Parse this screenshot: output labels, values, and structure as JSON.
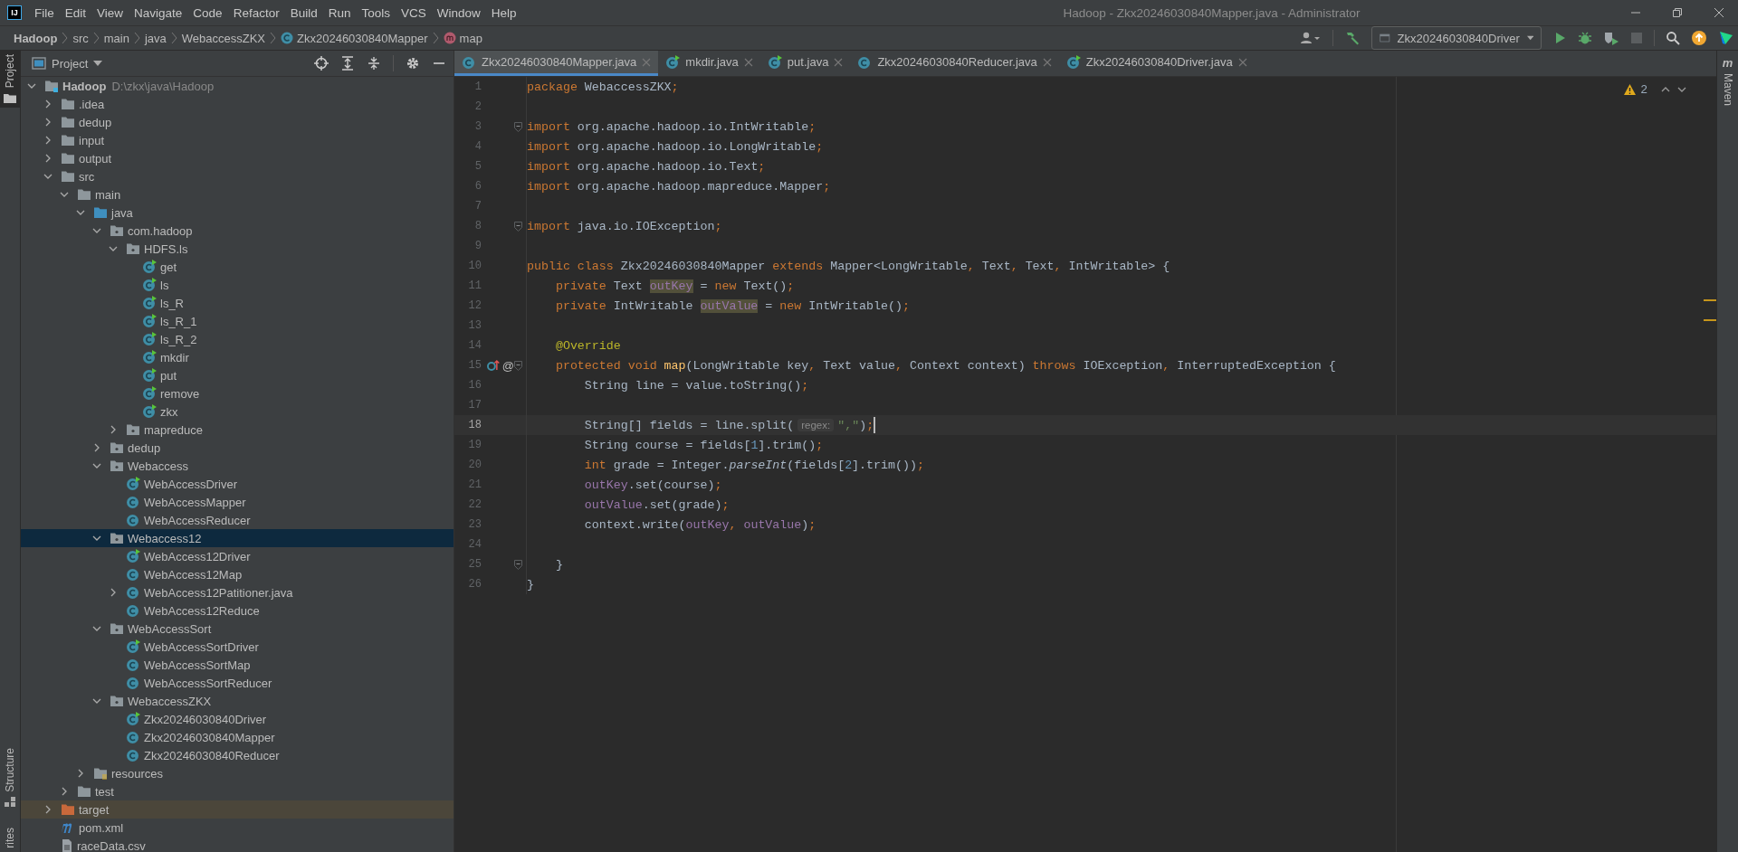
{
  "window": {
    "logo": "IJ",
    "title": "Hadoop - Zkx20246030840Mapper.java - Administrator"
  },
  "menu": [
    "File",
    "Edit",
    "View",
    "Navigate",
    "Code",
    "Refactor",
    "Build",
    "Run",
    "Tools",
    "VCS",
    "Window",
    "Help"
  ],
  "breadcrumb": [
    {
      "label": "Hadoop",
      "kind": "project"
    },
    {
      "label": "src",
      "kind": "folder"
    },
    {
      "label": "main",
      "kind": "folder"
    },
    {
      "label": "java",
      "kind": "folder"
    },
    {
      "label": "WebaccessZKX",
      "kind": "folder"
    },
    {
      "label": "Zkx20246030840Mapper",
      "kind": "class"
    },
    {
      "label": "map",
      "kind": "method"
    }
  ],
  "run_config": "Zkx20246030840Driver",
  "left_stripe": {
    "top": [
      {
        "label": "Project",
        "selected": true
      }
    ],
    "bottom": [
      {
        "label": "Structure",
        "selected": false
      },
      {
        "label": "rites",
        "selected": false
      }
    ]
  },
  "project_panel": {
    "title": "Project"
  },
  "tree": [
    {
      "label": "Hadoop",
      "path": "D:\\zkx\\java\\Hadoop",
      "kind": "module",
      "expanded": true,
      "selected": false,
      "children": [
        {
          "label": ".idea",
          "kind": "folder",
          "expanded": false,
          "selected": false
        },
        {
          "label": "dedup",
          "kind": "folder",
          "expanded": false,
          "selected": false
        },
        {
          "label": "input",
          "kind": "folder",
          "expanded": false,
          "selected": false
        },
        {
          "label": "output",
          "kind": "folder",
          "expanded": false,
          "selected": false
        },
        {
          "label": "src",
          "kind": "folder",
          "expanded": true,
          "selected": false,
          "children": [
            {
              "label": "main",
              "kind": "folder",
              "expanded": true,
              "selected": false,
              "children": [
                {
                  "label": "java",
                  "kind": "source",
                  "expanded": true,
                  "selected": false,
                  "children": [
                    {
                      "label": "com.hadoop",
                      "kind": "package",
                      "expanded": true,
                      "selected": false,
                      "children": [
                        {
                          "label": "HDFS.ls",
                          "kind": "package",
                          "expanded": true,
                          "selected": false,
                          "children": [
                            {
                              "label": "get",
                              "kind": "runclass",
                              "selected": false
                            },
                            {
                              "label": "ls",
                              "kind": "runclass",
                              "selected": false
                            },
                            {
                              "label": "ls_R",
                              "kind": "runclass",
                              "selected": false
                            },
                            {
                              "label": "ls_R_1",
                              "kind": "runclass",
                              "selected": false
                            },
                            {
                              "label": "ls_R_2",
                              "kind": "runclass",
                              "selected": false
                            },
                            {
                              "label": "mkdir",
                              "kind": "runclass",
                              "selected": false
                            },
                            {
                              "label": "put",
                              "kind": "runclass",
                              "selected": false
                            },
                            {
                              "label": "remove",
                              "kind": "runclass",
                              "selected": false
                            },
                            {
                              "label": "zkx",
                              "kind": "runclass",
                              "selected": false
                            }
                          ]
                        },
                        {
                          "label": "mapreduce",
                          "kind": "package",
                          "expanded": false,
                          "selected": false
                        }
                      ]
                    },
                    {
                      "label": "dedup",
                      "kind": "package",
                      "expanded": false,
                      "selected": false
                    },
                    {
                      "label": "Webaccess",
                      "kind": "package",
                      "expanded": true,
                      "selected": false,
                      "children": [
                        {
                          "label": "WebAccessDriver",
                          "kind": "runclass",
                          "selected": false
                        },
                        {
                          "label": "WebAccessMapper",
                          "kind": "class",
                          "selected": false
                        },
                        {
                          "label": "WebAccessReducer",
                          "kind": "class",
                          "selected": false
                        }
                      ]
                    },
                    {
                      "label": "Webaccess12",
                      "kind": "package",
                      "expanded": true,
                      "selected": true,
                      "children": [
                        {
                          "label": "WebAccess12Driver",
                          "kind": "runclass",
                          "selected": false
                        },
                        {
                          "label": "WebAccess12Map",
                          "kind": "class",
                          "selected": false
                        },
                        {
                          "label": "WebAccess12Patitioner.java",
                          "kind": "class",
                          "expanded": false,
                          "selected": false
                        },
                        {
                          "label": "WebAccess12Reduce",
                          "kind": "class",
                          "selected": false
                        }
                      ]
                    },
                    {
                      "label": "WebAccessSort",
                      "kind": "package",
                      "expanded": true,
                      "selected": false,
                      "children": [
                        {
                          "label": "WebAccessSortDriver",
                          "kind": "runclass",
                          "selected": false
                        },
                        {
                          "label": "WebAccessSortMap",
                          "kind": "class",
                          "selected": false
                        },
                        {
                          "label": "WebAccessSortReducer",
                          "kind": "class",
                          "selected": false
                        }
                      ]
                    },
                    {
                      "label": "WebaccessZKX",
                      "kind": "package",
                      "expanded": true,
                      "selected": false,
                      "children": [
                        {
                          "label": "Zkx20246030840Driver",
                          "kind": "runclass",
                          "selected": false
                        },
                        {
                          "label": "Zkx20246030840Mapper",
                          "kind": "class",
                          "selected": false
                        },
                        {
                          "label": "Zkx20246030840Reducer",
                          "kind": "class",
                          "selected": false
                        }
                      ]
                    }
                  ]
                },
                {
                  "label": "resources",
                  "kind": "resources",
                  "expanded": false,
                  "selected": false
                }
              ]
            },
            {
              "label": "test",
              "kind": "folder",
              "expanded": false,
              "selected": false
            }
          ]
        },
        {
          "label": "target",
          "kind": "excluded",
          "expanded": false,
          "selected": false
        },
        {
          "label": "pom.xml",
          "kind": "maven",
          "selected": false
        },
        {
          "label": "raceData.csv",
          "kind": "csv",
          "selected": false
        }
      ]
    }
  ],
  "tabs": [
    {
      "label": "Zkx20246030840Mapper.java",
      "kind": "class",
      "selected": true
    },
    {
      "label": "mkdir.java",
      "kind": "runclass",
      "selected": false
    },
    {
      "label": "put.java",
      "kind": "runclass",
      "selected": false
    },
    {
      "label": "Zkx20246030840Reducer.java",
      "kind": "class",
      "selected": false
    },
    {
      "label": "Zkx20246030840Driver.java",
      "kind": "runclass",
      "selected": false
    }
  ],
  "inspection": {
    "warnings": "2"
  },
  "right_stripe": {
    "icon": "m",
    "label": "Maven"
  },
  "code": [
    {
      "number": "1",
      "tokens": [
        {
          "kind": "kw",
          "text": "package"
        },
        {
          "kind": "txt",
          "text": " WebaccessZKX"
        },
        {
          "kind": "kw",
          "text": ";"
        }
      ]
    },
    {
      "number": "2"
    },
    {
      "number": "3",
      "fold": true,
      "tokens": [
        {
          "kind": "kw",
          "text": "import"
        },
        {
          "kind": "txt",
          "text": " org.apache.hadoop.io.IntWritable"
        },
        {
          "kind": "kw",
          "text": ";"
        }
      ]
    },
    {
      "number": "4",
      "tokens": [
        {
          "kind": "kw",
          "text": "import"
        },
        {
          "kind": "txt",
          "text": " org.apache.hadoop.io.LongWritable"
        },
        {
          "kind": "kw",
          "text": ";"
        }
      ]
    },
    {
      "number": "5",
      "tokens": [
        {
          "kind": "kw",
          "text": "import"
        },
        {
          "kind": "txt",
          "text": " org.apache.hadoop.io.Text"
        },
        {
          "kind": "kw",
          "text": ";"
        }
      ]
    },
    {
      "number": "6",
      "tokens": [
        {
          "kind": "kw",
          "text": "import"
        },
        {
          "kind": "txt",
          "text": " org.apache.hadoop.mapreduce.Mapper"
        },
        {
          "kind": "kw",
          "text": ";"
        }
      ]
    },
    {
      "number": "7"
    },
    {
      "number": "8",
      "fold": true,
      "tokens": [
        {
          "kind": "kw",
          "text": "import"
        },
        {
          "kind": "txt",
          "text": " java.io.IOException"
        },
        {
          "kind": "kw",
          "text": ";"
        }
      ]
    },
    {
      "number": "9"
    },
    {
      "number": "10",
      "tokens": [
        {
          "kind": "kw",
          "text": "public class"
        },
        {
          "kind": "txt",
          "text": " Zkx20246030840Mapper "
        },
        {
          "kind": "kw",
          "text": "extends"
        },
        {
          "kind": "txt",
          "text": " Mapper<LongWritable"
        },
        {
          "kind": "kw",
          "text": ","
        },
        {
          "kind": "txt",
          "text": " Text"
        },
        {
          "kind": "kw",
          "text": ","
        },
        {
          "kind": "txt",
          "text": " Text"
        },
        {
          "kind": "kw",
          "text": ","
        },
        {
          "kind": "txt",
          "text": " IntWritable> {"
        }
      ]
    },
    {
      "number": "11",
      "tokens": [
        {
          "kind": "kw",
          "text": "    private"
        },
        {
          "kind": "txt",
          "text": " Text "
        },
        {
          "kind": "unused",
          "text": "outKey"
        },
        {
          "kind": "txt",
          "text": " = "
        },
        {
          "kind": "kw",
          "text": "new"
        },
        {
          "kind": "txt",
          "text": " Text()"
        },
        {
          "kind": "kw",
          "text": ";"
        }
      ]
    },
    {
      "number": "12",
      "tokens": [
        {
          "kind": "kw",
          "text": "    private"
        },
        {
          "kind": "txt",
          "text": " IntWritable "
        },
        {
          "kind": "unused",
          "text": "outValue"
        },
        {
          "kind": "txt",
          "text": " = "
        },
        {
          "kind": "kw",
          "text": "new"
        },
        {
          "kind": "txt",
          "text": " IntWritable()"
        },
        {
          "kind": "kw",
          "text": ";"
        }
      ]
    },
    {
      "number": "13"
    },
    {
      "number": "14",
      "tokens": [
        {
          "kind": "annot",
          "text": "    @Override"
        }
      ]
    },
    {
      "number": "15",
      "fold": true,
      "overrides": true,
      "annotation_mark": "@",
      "tokens": [
        {
          "kind": "kw",
          "text": "    protected void "
        },
        {
          "kind": "method",
          "text": "map"
        },
        {
          "kind": "txt",
          "text": "(LongWritable key"
        },
        {
          "kind": "kw",
          "text": ","
        },
        {
          "kind": "txt",
          "text": " Text value"
        },
        {
          "kind": "kw",
          "text": ","
        },
        {
          "kind": "txt",
          "text": " Context context) "
        },
        {
          "kind": "kw",
          "text": "throws"
        },
        {
          "kind": "txt",
          "text": " IOException"
        },
        {
          "kind": "kw",
          "text": ","
        },
        {
          "kind": "txt",
          "text": " InterruptedException {"
        }
      ]
    },
    {
      "number": "16",
      "tokens": [
        {
          "kind": "txt",
          "text": "        String line = value.toString()"
        },
        {
          "kind": "kw",
          "text": ";"
        }
      ]
    },
    {
      "number": "17"
    },
    {
      "number": "18",
      "current": true,
      "tokens": [
        {
          "kind": "txt",
          "text": "        String[] fields = line.split("
        },
        {
          "kind": "hint",
          "text": "regex:"
        },
        {
          "kind": "str",
          "text": "\",\""
        },
        {
          "kind": "txt",
          "text": ")"
        },
        {
          "kind": "kw",
          "text": ";"
        }
      ]
    },
    {
      "number": "19",
      "tokens": [
        {
          "kind": "txt",
          "text": "        String course = fields["
        },
        {
          "kind": "num",
          "text": "1"
        },
        {
          "kind": "txt",
          "text": "].trim()"
        },
        {
          "kind": "kw",
          "text": ";"
        }
      ]
    },
    {
      "number": "20",
      "tokens": [
        {
          "kind": "kw",
          "text": "        int"
        },
        {
          "kind": "txt",
          "text": " grade = Integer."
        },
        {
          "kind": "static",
          "text": "parseInt"
        },
        {
          "kind": "txt",
          "text": "(fields["
        },
        {
          "kind": "num",
          "text": "2"
        },
        {
          "kind": "txt",
          "text": "].trim())"
        },
        {
          "kind": "kw",
          "text": ";"
        }
      ]
    },
    {
      "number": "21",
      "tokens": [
        {
          "kind": "field",
          "text": "        outKey"
        },
        {
          "kind": "txt",
          "text": ".set(course)"
        },
        {
          "kind": "kw",
          "text": ";"
        }
      ]
    },
    {
      "number": "22",
      "tokens": [
        {
          "kind": "field",
          "text": "        outValue"
        },
        {
          "kind": "txt",
          "text": ".set(grade)"
        },
        {
          "kind": "kw",
          "text": ";"
        }
      ]
    },
    {
      "number": "23",
      "tokens": [
        {
          "kind": "txt",
          "text": "        context.write("
        },
        {
          "kind": "field",
          "text": "outKey"
        },
        {
          "kind": "kw",
          "text": ", "
        },
        {
          "kind": "field",
          "text": "outValue"
        },
        {
          "kind": "txt",
          "text": ")"
        },
        {
          "kind": "kw",
          "text": ";"
        }
      ]
    },
    {
      "number": "24"
    },
    {
      "number": "25",
      "fold": true,
      "tokens": [
        {
          "kind": "txt",
          "text": "    }"
        }
      ]
    },
    {
      "number": "26",
      "tokens": [
        {
          "kind": "txt",
          "text": "}"
        }
      ]
    }
  ]
}
